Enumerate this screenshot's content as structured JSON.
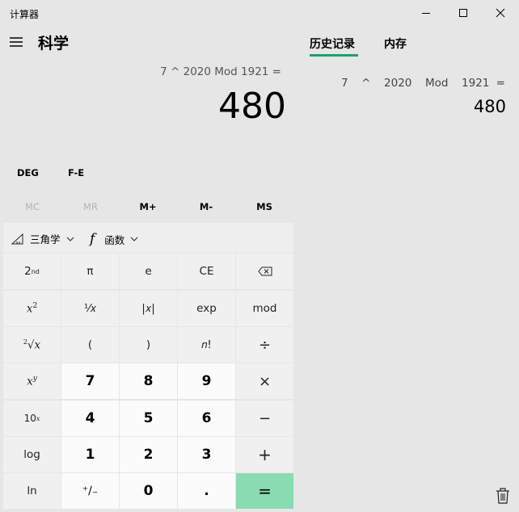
{
  "window": {
    "title": "计算器"
  },
  "header": {
    "mode_title": "科学",
    "tabs": [
      {
        "label": "历史记录"
      },
      {
        "label": "内存"
      }
    ]
  },
  "display": {
    "expression": "7 ^ 2020 Mod 1921 =",
    "result": "480"
  },
  "history": {
    "expression": "7  ^  2020  Mod  1921 =",
    "result": "480"
  },
  "modes": {
    "angle": "DEG",
    "fe": "F-E"
  },
  "memory": [
    "MC",
    "MR",
    "M+",
    "M-",
    "MS"
  ],
  "functions": {
    "trig_label": "三角学",
    "func_label": "函数"
  },
  "keys": {
    "second": "2",
    "second_sup": "nd",
    "pi": "π",
    "e": "e",
    "ce": "CE",
    "reciprocal": "⅟𝑥",
    "abs": "|𝑥|",
    "exp": "exp",
    "mod": "mod",
    "lparen": "(",
    "rparen": ")",
    "factorial": "𝑛!",
    "divide": "÷",
    "seven": "7",
    "eight": "8",
    "nine": "9",
    "multiply": "×",
    "ten": "10",
    "four": "4",
    "five": "5",
    "six": "6",
    "minus": "−",
    "log": "log",
    "one": "1",
    "two": "2",
    "three": "3",
    "plus": "+",
    "ln": "ln",
    "negate": "⁺∕₋",
    "zero": "0",
    "decimal": ".",
    "equals": "="
  },
  "colors": {
    "accent": "#1aa26b",
    "equals_bg": "#89dbb1",
    "background": "#e6e6e6"
  }
}
